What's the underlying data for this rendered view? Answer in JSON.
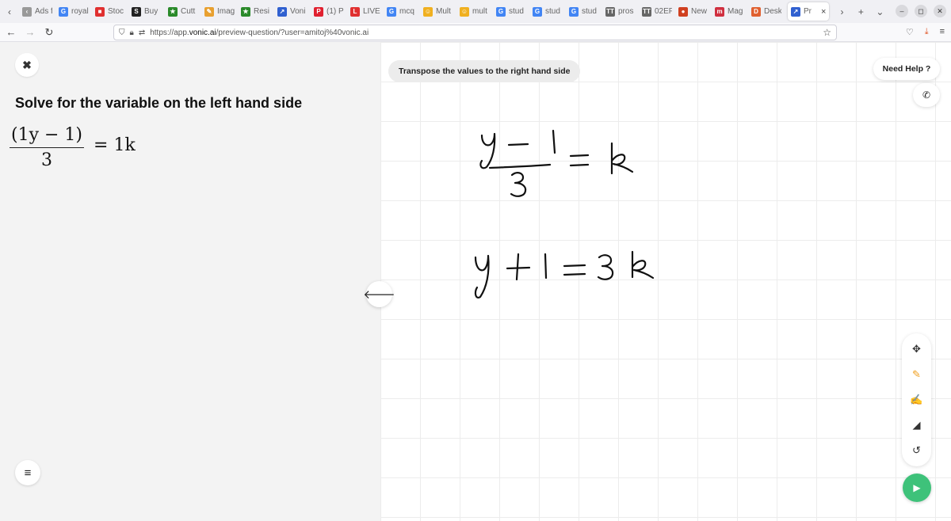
{
  "browser": {
    "tabs": [
      {
        "label": "Ads f",
        "icon": "ads-icon",
        "color": "#999999",
        "glyph": "‹"
      },
      {
        "label": "royal",
        "icon": "google-icon",
        "color": "#4285f4",
        "glyph": "G"
      },
      {
        "label": "Stoc",
        "icon": "stock-icon",
        "color": "#e03030",
        "glyph": "■"
      },
      {
        "label": "Buy",
        "icon": "buy-icon",
        "color": "#222222",
        "glyph": "S"
      },
      {
        "label": "Cutt",
        "icon": "cutt-icon",
        "color": "#2a8a2a",
        "glyph": "★"
      },
      {
        "label": "Imag",
        "icon": "image-icon",
        "color": "#e8a030",
        "glyph": "✎"
      },
      {
        "label": "Resi",
        "icon": "resi-icon",
        "color": "#2a8a2a",
        "glyph": "★"
      },
      {
        "label": "Voni",
        "icon": "vonic-icon",
        "color": "#3060d0",
        "glyph": "↗"
      },
      {
        "label": "(1) P",
        "icon": "pinterest-icon",
        "color": "#e02030",
        "glyph": "P"
      },
      {
        "label": "LIVE",
        "icon": "live-icon",
        "color": "#e03030",
        "glyph": "L"
      },
      {
        "label": "mcq",
        "icon": "google-icon",
        "color": "#4285f4",
        "glyph": "G"
      },
      {
        "label": "Mult",
        "icon": "mult-icon",
        "color": "#f0b020",
        "glyph": "☺"
      },
      {
        "label": "mult",
        "icon": "mult-icon",
        "color": "#f0b020",
        "glyph": "☺"
      },
      {
        "label": "stud",
        "icon": "google-icon",
        "color": "#4285f4",
        "glyph": "G"
      },
      {
        "label": "stud",
        "icon": "google-icon",
        "color": "#4285f4",
        "glyph": "G"
      },
      {
        "label": "stud",
        "icon": "google-icon",
        "color": "#4285f4",
        "glyph": "G"
      },
      {
        "label": "pros",
        "icon": "pros-icon",
        "color": "#666666",
        "glyph": "TT"
      },
      {
        "label": "02EF",
        "icon": "02ef-icon",
        "color": "#666666",
        "glyph": "TT"
      },
      {
        "label": "New",
        "icon": "news-icon",
        "color": "#d04020",
        "glyph": "●"
      },
      {
        "label": "Mag",
        "icon": "mag-icon",
        "color": "#d03040",
        "glyph": "m"
      },
      {
        "label": "Desk",
        "icon": "desk-icon",
        "color": "#e06030",
        "glyph": "D"
      }
    ],
    "active_tab": {
      "label": "Pr",
      "icon": "vonic-icon",
      "color": "#3060d0",
      "glyph": "↗",
      "close": "×"
    },
    "url_prefix": "https://app.",
    "url_domain": "vonic.ai",
    "url_path": "/preview-question/?user=amitoj%40vonic.ai"
  },
  "question": {
    "title": "Solve for the variable on the left hand side",
    "numerator": "(1y − 1)",
    "denominator": "3",
    "rhs": "= 1k"
  },
  "canvas": {
    "instruction": "Transpose the values to the right hand side",
    "help_label": "Need Help ?"
  },
  "colors": {
    "accent_green": "#3ec27a",
    "pencil_orange": "#f0a020",
    "panel_bg": "#f3f3f3"
  }
}
